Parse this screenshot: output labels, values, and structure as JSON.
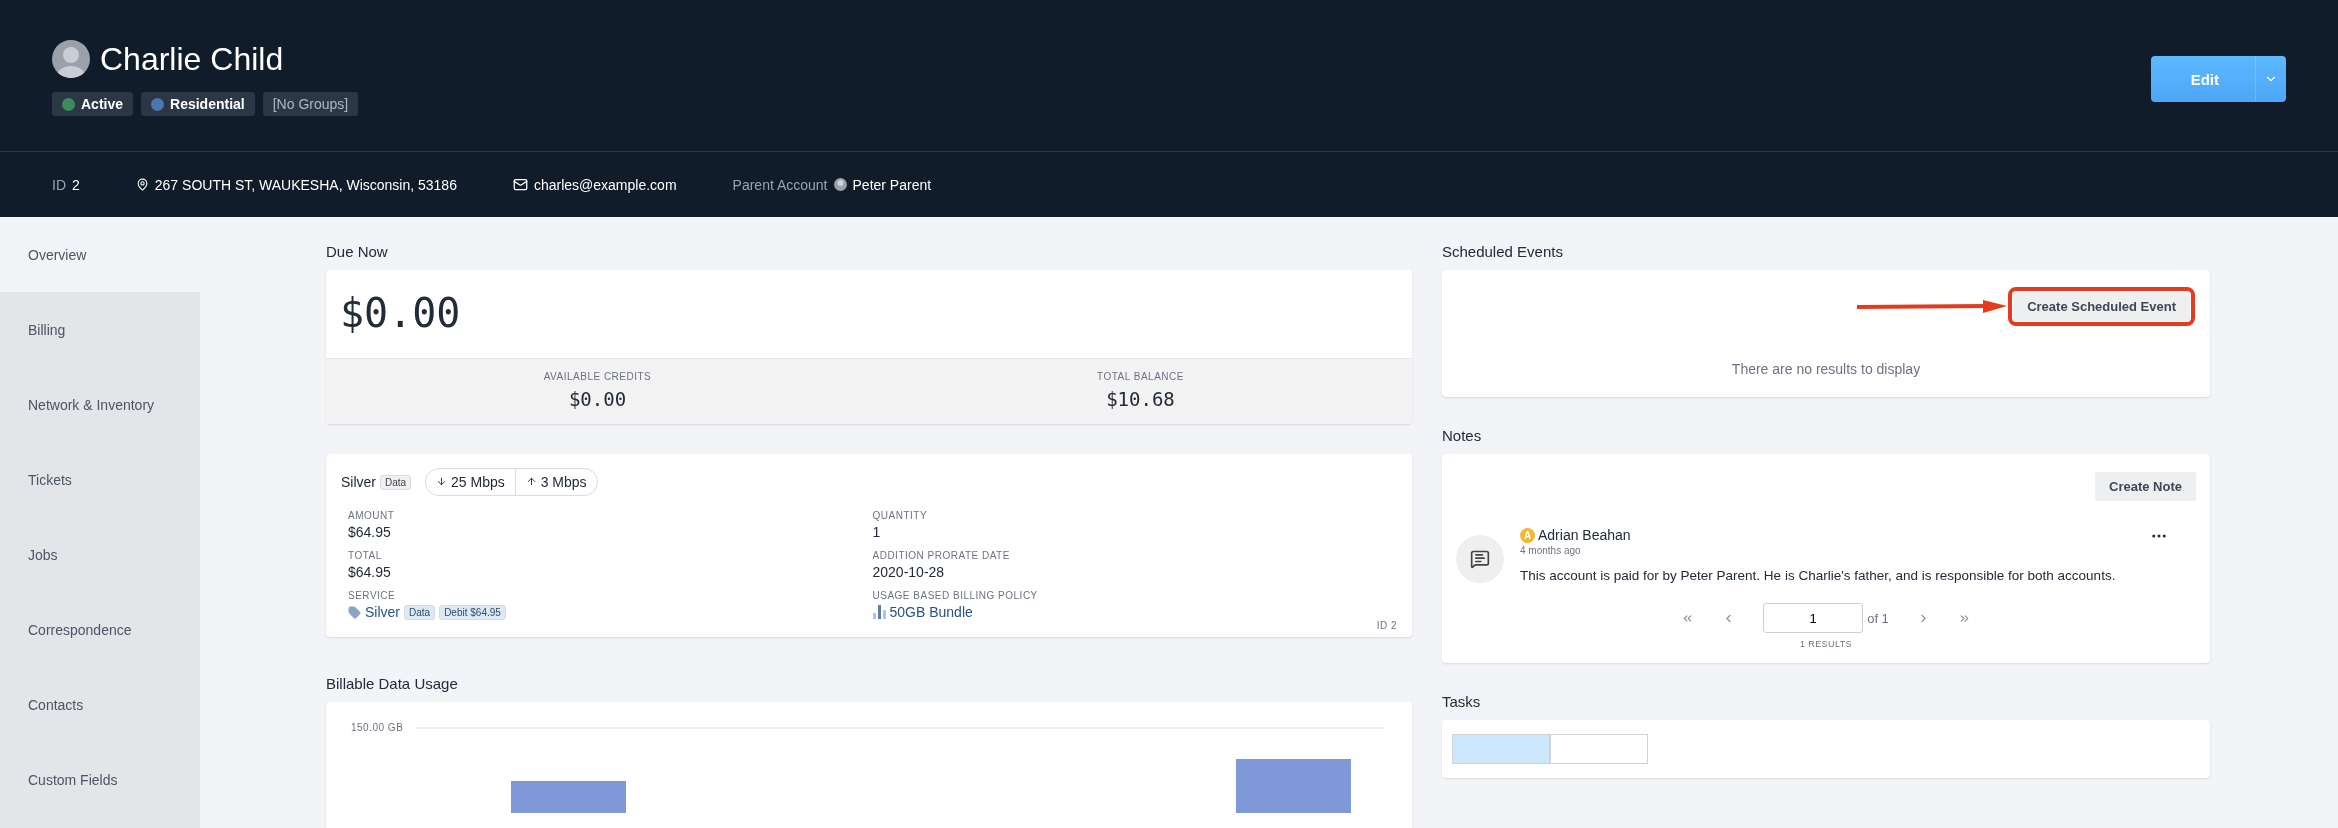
{
  "header": {
    "name": "Charlie Child",
    "edit_button": "Edit",
    "tags": [
      {
        "label": "Active",
        "color": "#3f8a5a"
      },
      {
        "label": "Residential",
        "color": "#4a77b0"
      },
      {
        "label": "[No Groups]"
      }
    ]
  },
  "info_bar": {
    "id_label": "ID",
    "id": "2",
    "address": "267 SOUTH ST, WAUKESHA, Wisconsin, 53186",
    "email": "charles@example.com",
    "parent_label": "Parent Account",
    "parent": "Peter Parent"
  },
  "sidebar": {
    "items": [
      {
        "label": "Overview",
        "selected": true
      },
      {
        "label": "Billing",
        "selected": false
      },
      {
        "label": "Network & Inventory",
        "selected": false
      },
      {
        "label": "Tickets",
        "selected": false
      },
      {
        "label": "Jobs",
        "selected": false
      },
      {
        "label": "Correspondence",
        "selected": false
      },
      {
        "label": "Contacts",
        "selected": false
      },
      {
        "label": "Custom Fields",
        "selected": false
      }
    ]
  },
  "due_now": {
    "title": "Due Now",
    "amount": "$0.00",
    "stats": [
      {
        "label": "AVAILABLE CREDITS",
        "value": "$0.00"
      },
      {
        "label": "TOTAL BALANCE",
        "value": "$10.68"
      }
    ]
  },
  "service": {
    "name": "Silver",
    "type": "Data",
    "down": "25 Mbps",
    "up": "3 Mbps",
    "id": "ID 2",
    "fields": [
      {
        "kind": "text",
        "label": "AMOUNT",
        "value": "$64.95"
      },
      {
        "kind": "text",
        "label": "QUANTITY",
        "value": "1"
      },
      {
        "kind": "text",
        "label": "TOTAL",
        "value": "$64.95"
      },
      {
        "kind": "text",
        "label": "ADDITION PRORATE DATE",
        "value": "2020-10-28"
      },
      {
        "kind": "service",
        "label": "SERVICE",
        "link": "Silver",
        "badges": [
          "Data",
          "Debit $64.95"
        ]
      },
      {
        "kind": "policy",
        "label": "USAGE BASED BILLING POLICY",
        "link": "50GB Bundle"
      }
    ]
  },
  "usage": {
    "title": "Billable Data Usage",
    "axis_label": "150.00 GB"
  },
  "scheduled_events": {
    "title": "Scheduled Events",
    "button": "Create Scheduled Event",
    "highlighted": true,
    "empty": "There are no results to display"
  },
  "notes": {
    "title": "Notes",
    "button": "Create Note",
    "items": [
      {
        "initial": "A",
        "author": "Adrian Beahan",
        "time": "4 months ago",
        "text": "This account is paid for by Peter Parent. He is Charlie's father, and is responsible for both accounts."
      }
    ],
    "pagination": {
      "page": "1",
      "of": "of 1",
      "results": "1 RESULTS"
    }
  },
  "tasks": {
    "title": "Tasks"
  }
}
